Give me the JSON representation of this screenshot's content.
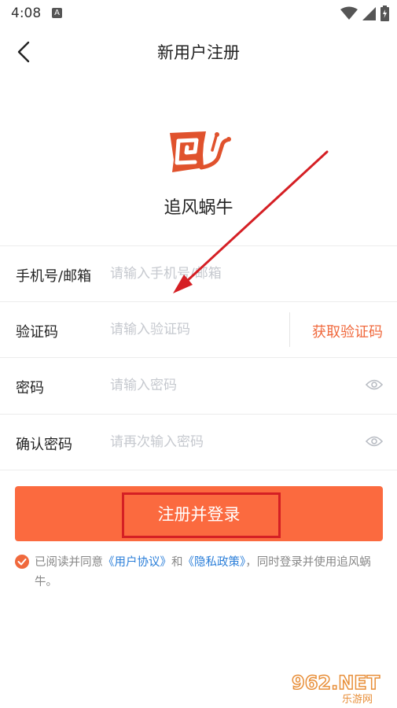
{
  "status_bar": {
    "time": "4:08",
    "notif_letter": "A"
  },
  "header": {
    "title": "新用户注册"
  },
  "app": {
    "name": "追风蜗牛"
  },
  "form": {
    "phone": {
      "label": "手机号/邮箱",
      "placeholder": "请输入手机号/邮箱"
    },
    "code": {
      "label": "验证码",
      "placeholder": "请输入验证码",
      "get_code_label": "获取验证码"
    },
    "password": {
      "label": "密码",
      "placeholder": "请输入密码"
    },
    "confirm": {
      "label": "确认密码",
      "placeholder": "请再次输入密码"
    }
  },
  "submit": {
    "label": "注册并登录"
  },
  "agreement": {
    "prefix": "已阅读并同意",
    "user_agreement": "《用户协议》",
    "and": "和",
    "privacy_policy": "《隐私政策》",
    "suffix": "，同时登录并使用追风蜗牛。",
    "checked": true
  },
  "watermark": {
    "brand": "962.NET",
    "sub": "乐游网"
  },
  "colors": {
    "accent": "#fb6a3f",
    "link": "#2a7ed9",
    "annotation": "#d51f24"
  }
}
